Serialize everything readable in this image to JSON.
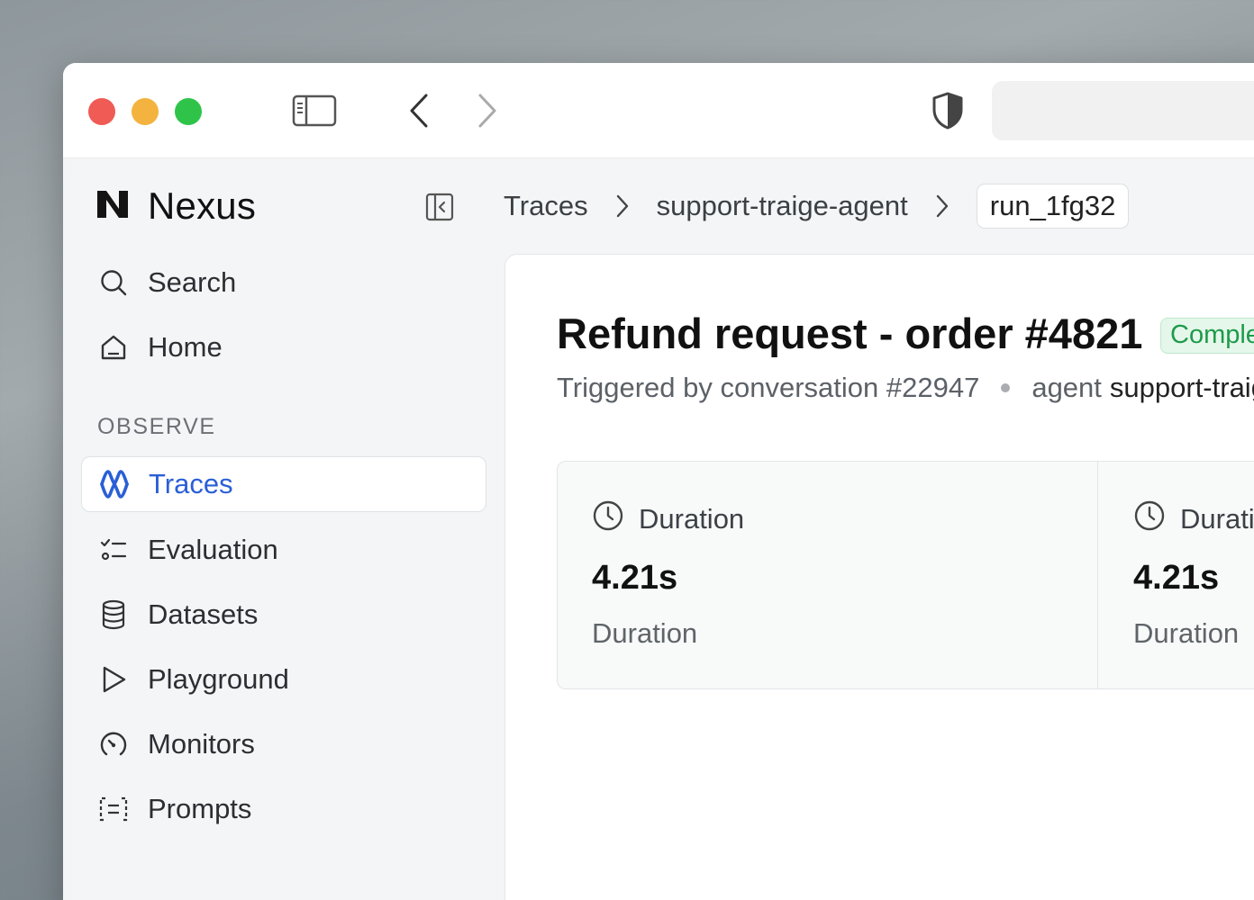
{
  "app": {
    "name": "Nexus"
  },
  "sidebar": {
    "top_items": [
      {
        "label": "Search",
        "icon": "search-icon"
      },
      {
        "label": "Home",
        "icon": "home-icon"
      }
    ],
    "section_label": "OBSERVE",
    "items": [
      {
        "label": "Traces",
        "icon": "traces-icon",
        "active": true
      },
      {
        "label": "Evaluation",
        "icon": "checklist-icon"
      },
      {
        "label": "Datasets",
        "icon": "database-icon"
      },
      {
        "label": "Playground",
        "icon": "play-icon"
      },
      {
        "label": "Monitors",
        "icon": "gauge-icon"
      },
      {
        "label": "Prompts",
        "icon": "prompt-icon"
      }
    ]
  },
  "breadcrumb": {
    "items": [
      "Traces",
      "support-traige-agent"
    ],
    "current": "run_1fg32"
  },
  "main": {
    "title": "Refund request - order #4821",
    "status": "Complete",
    "subtitle_trigger": "Triggered by conversation #22947",
    "subtitle_agent_prefix": "agent",
    "subtitle_agent_name": "support-traige-agent",
    "stats": [
      {
        "heading": "Duration",
        "value": "4.21s",
        "label": "Duration",
        "icon": "clock-icon"
      },
      {
        "heading": "Duration",
        "value": "4.21s",
        "label": "Duration",
        "icon": "clock-icon"
      }
    ]
  },
  "colors": {
    "accent": "#2a5fd6",
    "status_green": "#1e9a4b",
    "traffic_red": "#f05b55",
    "traffic_yellow": "#f4b33f",
    "traffic_green": "#2fc449"
  }
}
